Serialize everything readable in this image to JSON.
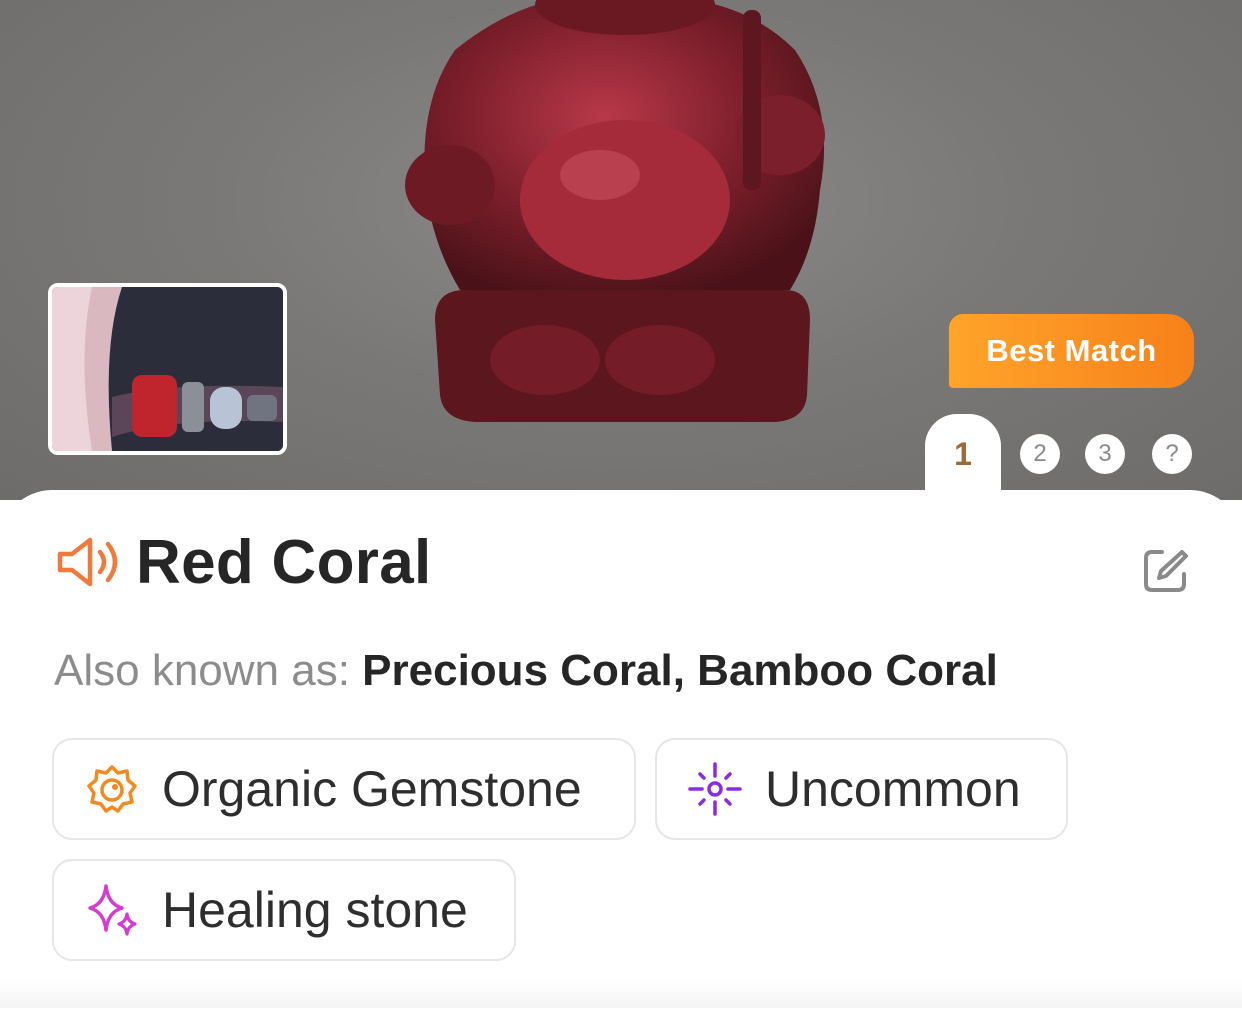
{
  "hero": {
    "badge": "Best Match",
    "tabs": [
      {
        "label": "1",
        "active": true
      },
      {
        "label": "2",
        "active": false
      },
      {
        "label": "3",
        "active": false
      },
      {
        "label": "?",
        "active": false
      }
    ]
  },
  "result": {
    "name": "Red Coral",
    "aka_label": "Also known as:",
    "aka_values": "Precious Coral, Bamboo Coral",
    "tags": [
      {
        "label": "Organic Gemstone",
        "icon": "shell-gem-icon",
        "color": "#f28a1f"
      },
      {
        "label": "Uncommon",
        "icon": "sparkle-burst-icon",
        "color": "#8a2be2"
      },
      {
        "label": "Healing stone",
        "icon": "sparkles-icon",
        "color": "#d63bd0"
      }
    ]
  },
  "colors": {
    "accent": "#f7811a",
    "tab_active_text": "#9b6b3c",
    "speaker_icon": "#f07a3a"
  }
}
